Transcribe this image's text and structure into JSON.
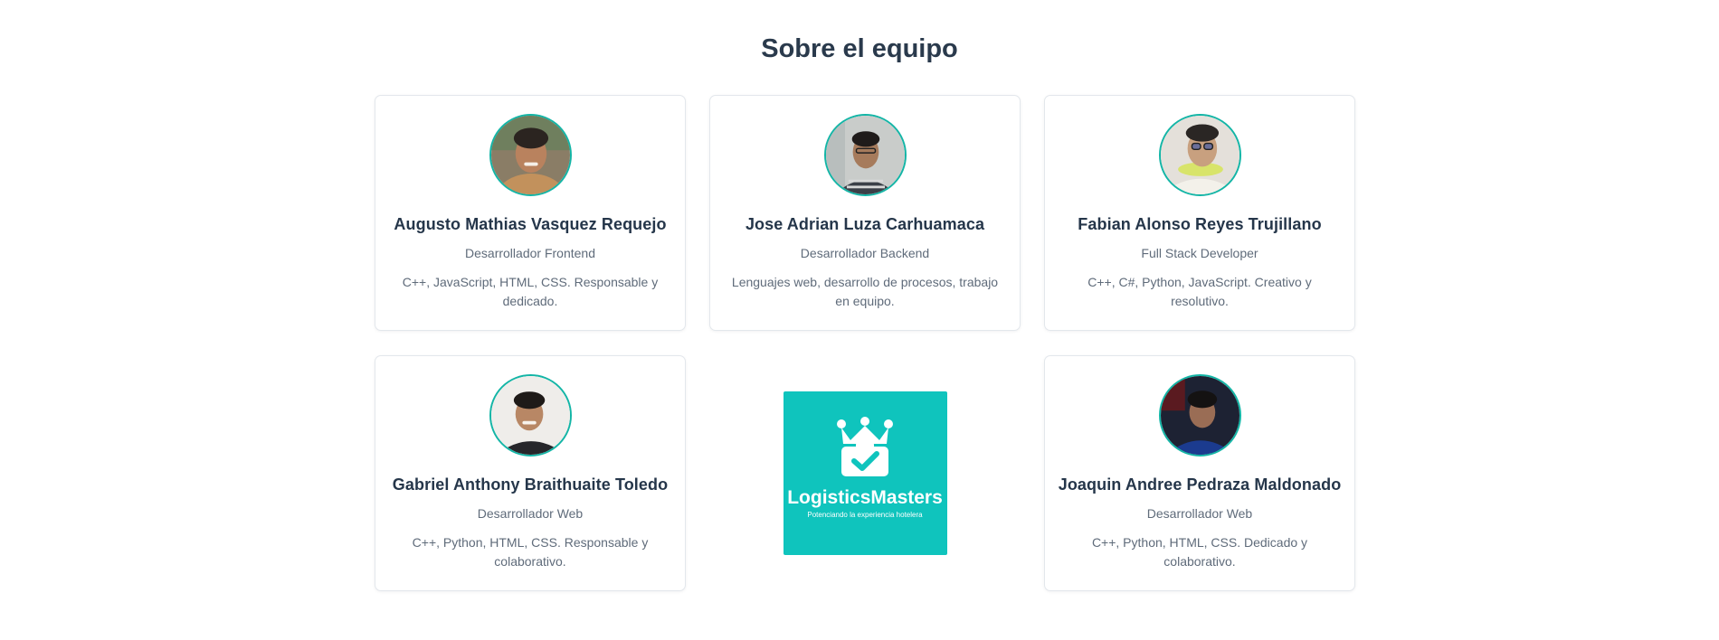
{
  "section": {
    "title": "Sobre el equipo"
  },
  "members": [
    {
      "name": "Augusto Mathias Vasquez Requejo",
      "role": "Desarrollador Frontend",
      "description": "C++, JavaScript, HTML, CSS. Responsable y dedicado."
    },
    {
      "name": "Jose Adrian Luza Carhuamaca",
      "role": "Desarrollador Backend",
      "description": "Lenguajes web, desarrollo de procesos, trabajo en equipo."
    },
    {
      "name": "Fabian Alonso Reyes Trujillano",
      "role": "Full Stack Developer",
      "description": "C++, C#, Python, JavaScript. Creativo y resolutivo."
    },
    {
      "name": "Gabriel Anthony Braithuaite Toledo",
      "role": "Desarrollador Web",
      "description": "C++, Python, HTML, CSS. Responsable y colaborativo."
    },
    {
      "name": "Joaquin Andree Pedraza Maldonado",
      "role": "Desarrollador Web",
      "description": "C++, Python, HTML, CSS. Dedicado y colaborativo."
    }
  ],
  "logo": {
    "name": "LogisticsMasters",
    "tagline": "Potenciando la experiencia hotelera",
    "icon": "crown-briefcase-check-icon",
    "background_color": "#0fc4bd"
  },
  "colors": {
    "accent": "#13b5a6",
    "title": "#2a3a4c",
    "muted_text": "#5f6b7a"
  }
}
